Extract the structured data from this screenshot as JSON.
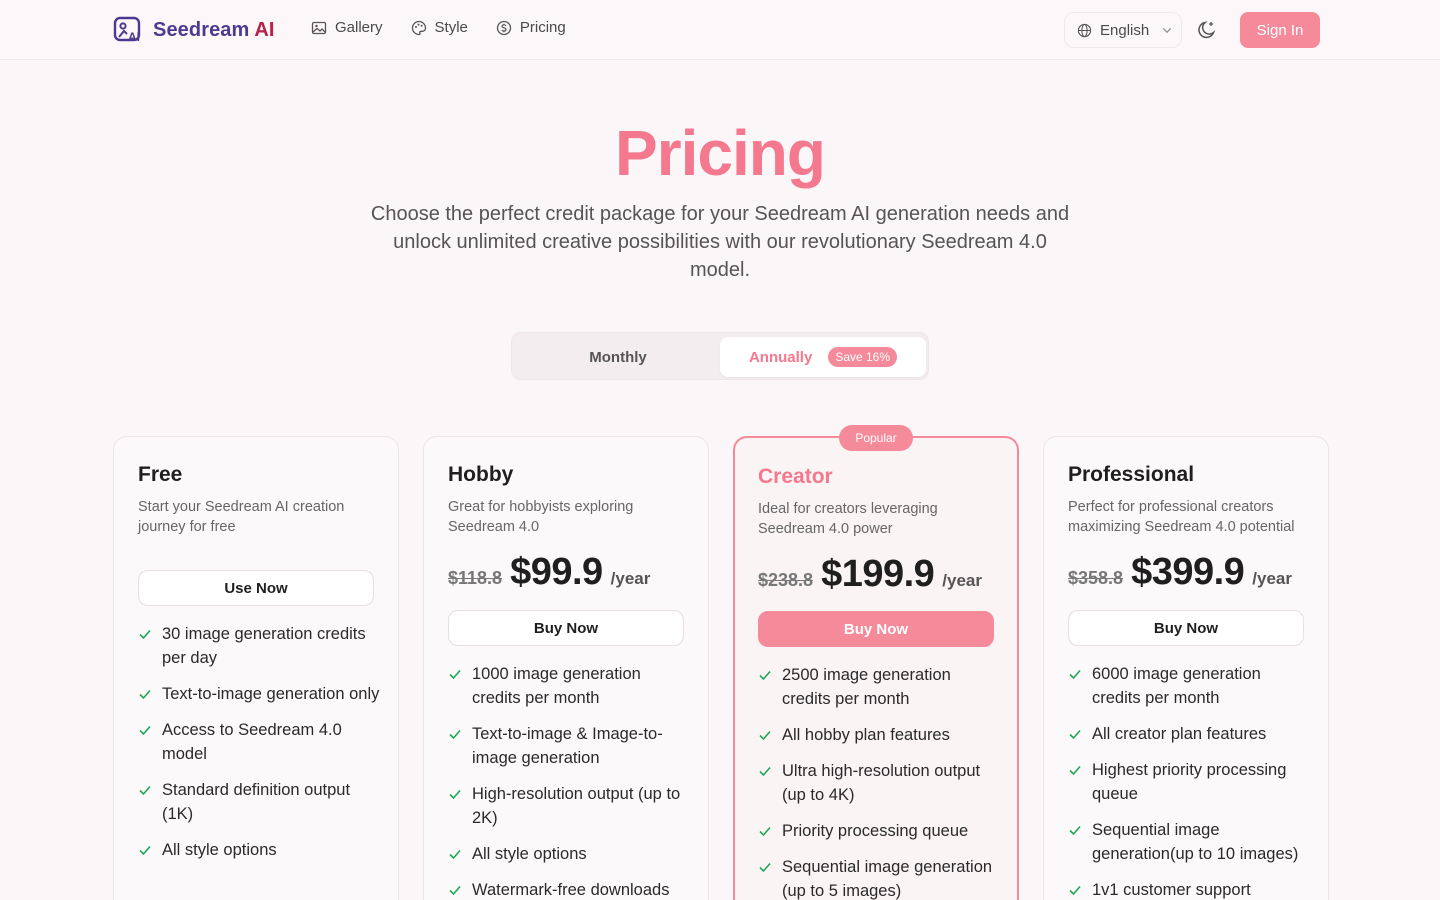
{
  "header": {
    "logo_text": "Seedream",
    "logo_ai": "AI",
    "nav": [
      {
        "label": "Gallery",
        "icon": "image-icon"
      },
      {
        "label": "Style",
        "icon": "palette-icon"
      },
      {
        "label": "Pricing",
        "icon": "dollar-circle-icon"
      }
    ],
    "language": "English",
    "sign_in": "Sign In"
  },
  "hero": {
    "title": "Pricing",
    "subtitle": "Choose the perfect credit package for your Seedream AI generation needs and unlock unlimited creative possibilities with our revolutionary Seedream 4.0 model."
  },
  "billing_toggle": {
    "monthly": "Monthly",
    "annually": "Annually",
    "save_badge": "Save 16%",
    "selected": "Annually"
  },
  "plans": [
    {
      "name": "Free",
      "description": "Start your Seedream AI creation journey for free",
      "cta": "Use Now",
      "features": [
        "30 image generation credits per day",
        "Text-to-image generation only",
        "Access to Seedream 4.0 model",
        "Standard definition output (1K)",
        "All style options"
      ]
    },
    {
      "name": "Hobby",
      "description": "Great for hobbyists exploring Seedream 4.0",
      "old_price": "$118.8",
      "price": "$99.9",
      "period": "/year",
      "cta": "Buy Now",
      "features": [
        "1000 image generation credits per month",
        "Text-to-image & Image-to-image generation",
        "High-resolution output (up to 2K)",
        "All style options",
        "Watermark-free downloads"
      ]
    },
    {
      "name": "Creator",
      "badge": "Popular",
      "description": "Ideal for creators leveraging Seedream 4.0 power",
      "old_price": "$238.8",
      "price": "$199.9",
      "period": "/year",
      "cta": "Buy Now",
      "features": [
        "2500 image generation credits per month",
        "All hobby plan features",
        "Ultra high-resolution output (up to 4K)",
        "Priority processing queue",
        "Sequential image generation (up to 5 images)"
      ]
    },
    {
      "name": "Professional",
      "description": "Perfect for professional creators maximizing Seedream 4.0 potential",
      "old_price": "$358.8",
      "price": "$399.9",
      "period": "/year",
      "cta": "Buy Now",
      "features": [
        "6000 image generation credits per month",
        "All creator plan features",
        "Highest priority processing queue",
        "Sequential image generation(up to 10 images)",
        "1v1 customer support"
      ]
    }
  ],
  "colors": {
    "accent": "#f58a9b",
    "accent_text": "#f4788e",
    "check": "#22a55a",
    "logo_purple": "#4b3b8f",
    "logo_red": "#b8204a"
  }
}
